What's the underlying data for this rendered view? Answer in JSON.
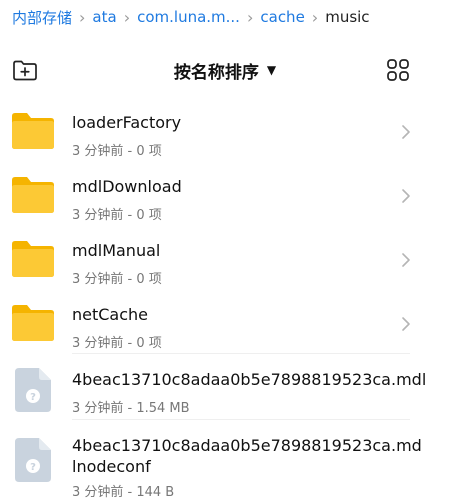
{
  "breadcrumb": {
    "items": [
      "内部存储",
      "ata",
      "com.luna.m...",
      "cache",
      "music"
    ]
  },
  "toolbar": {
    "sort_label": "按名称排序"
  },
  "colors": {
    "accent": "#1f7ae0",
    "folder": "#f9c11c",
    "file_icon": "#c9d3de"
  },
  "items": [
    {
      "name": "loaderFactory",
      "meta": "3 分钟前 - 0 项",
      "type": "folder"
    },
    {
      "name": "mdlDownload",
      "meta": "3 分钟前 - 0 项",
      "type": "folder"
    },
    {
      "name": "mdlManual",
      "meta": "3 分钟前 - 0 项",
      "type": "folder"
    },
    {
      "name": "netCache",
      "meta": "3 分钟前 - 0 项",
      "type": "folder"
    },
    {
      "name": "4beac13710c8adaa0b5e7898819523ca.mdl",
      "meta": "3 分钟前 - 1.54 MB",
      "type": "file"
    },
    {
      "name": "4beac13710c8adaa0b5e7898819523ca.mdlnodeconf",
      "meta": "3 分钟前 - 144 B",
      "type": "file"
    }
  ]
}
